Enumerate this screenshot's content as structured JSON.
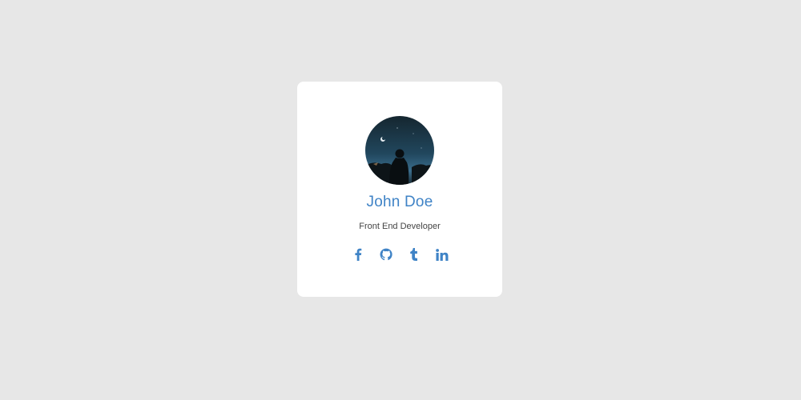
{
  "profile": {
    "name": "John Doe",
    "role": "Front End Developer",
    "avatar_icon": "person-silhouette-night-sky-photo"
  },
  "socials": [
    {
      "icon": "facebook-icon"
    },
    {
      "icon": "github-icon"
    },
    {
      "icon": "tumblr-icon"
    },
    {
      "icon": "linkedin-icon"
    }
  ],
  "colors": {
    "page_background": "#e7e7e7",
    "card_background": "#ffffff",
    "accent": "#3f83c6",
    "role_text": "#444444"
  }
}
